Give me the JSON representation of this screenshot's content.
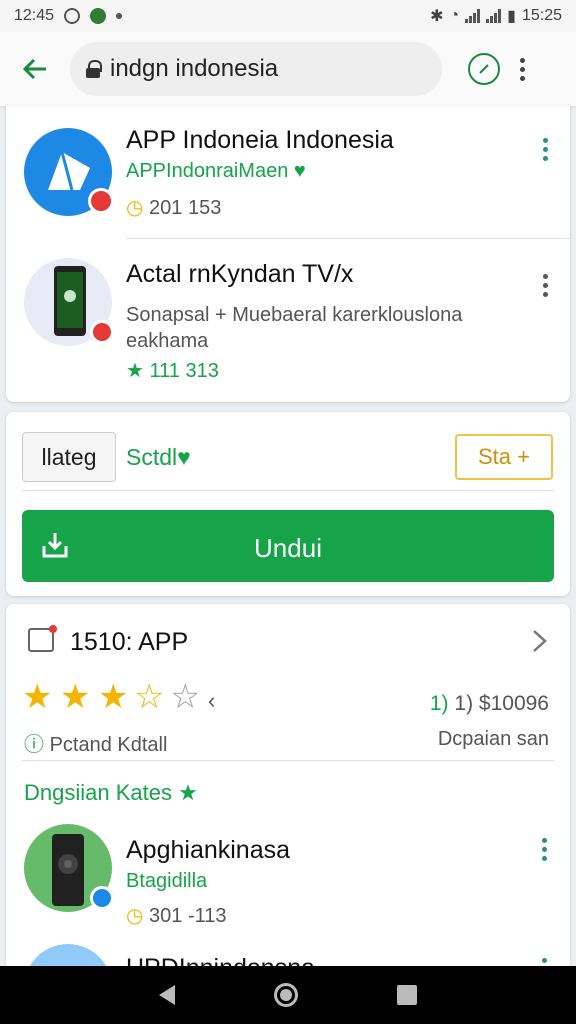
{
  "status_bar": {
    "time": "12:45",
    "battery": "15:25"
  },
  "url_bar": {
    "url": "indgn indonesia"
  },
  "results": [
    {
      "title": "APP Indoneia Indonesia",
      "developer": "APPIndonraiMaen",
      "meta": "201 153"
    },
    {
      "title": "Actal rnKyndan  TV/x",
      "description": "Sonapsal + Muebaeral karerklouslona\neakhama",
      "meta": "111 313"
    }
  ],
  "install": {
    "chip_label": "llateg",
    "status_text": "Sctdl",
    "sta_label": "Sta +",
    "download_label": "Undui"
  },
  "details": {
    "heading": "1510: APP",
    "rating_suffix": "‹",
    "price": "1) $10096",
    "left_label": "Pctand Kdtall",
    "right_label": "Dcpaian san"
  },
  "similar": {
    "heading": "Dngsiian Kates",
    "apps": [
      {
        "title": "Apghiankinasa",
        "developer": "Btagidilla",
        "meta": "301 -113"
      },
      {
        "title": "UPDInnindonsna"
      }
    ]
  },
  "colors": {
    "accent_green": "#16a34a",
    "brand_blue": "#1e88e5",
    "star_gold": "#f4b400"
  }
}
